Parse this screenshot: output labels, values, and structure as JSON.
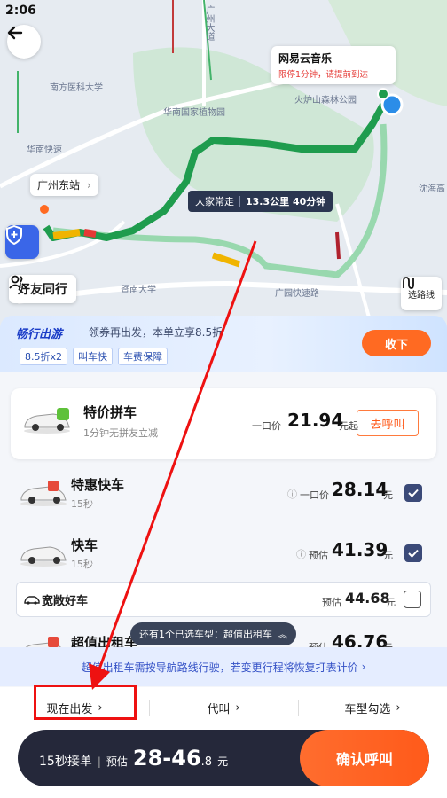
{
  "status": {
    "time": "2:06"
  },
  "map": {
    "start_label": "广州东站",
    "dest_name": "网易云音乐",
    "dest_note": "限停1分钟，请提前到达",
    "route_tip": {
      "tag": "大家常走",
      "detail": "13.3公里 40分钟"
    },
    "friends_label": "好友同行",
    "route_select_label": "选路线",
    "places": [
      "南方医科大学",
      "华南国家植物园",
      "火炉山森林公园",
      "暨南大学",
      "广园快速路",
      "沈海高",
      "广州大道",
      "华南快速"
    ]
  },
  "promo": {
    "logo": "畅行出游",
    "text": "领券再出发，本单立享8.5折",
    "tags": [
      "8.5折x2",
      "叫车快",
      "车费保障"
    ],
    "collect": "收下"
  },
  "cars": {
    "pool": {
      "name": "特价拼车",
      "sub": "1分钟无拼友立减",
      "price_label": "一口价",
      "price": "21.94",
      "unit": "元起",
      "call": "去呼叫"
    },
    "items": [
      {
        "name": "特惠快车",
        "sub": "15秒",
        "price_label": "一口价",
        "price": "28.14",
        "unit": "元",
        "checked": true
      },
      {
        "name": "快车",
        "sub": "15秒",
        "price_label": "预估",
        "price": "41.39",
        "unit": "元",
        "checked": true
      }
    ],
    "spacious": {
      "name": "宽敞好车",
      "price_label": "预估",
      "price": "44.68",
      "unit": "元"
    },
    "taxi": {
      "name": "超值出租车",
      "price_label": "预估",
      "price": "46.76",
      "unit": "元"
    },
    "more_pill": "还有1个已选车型：超值出租车",
    "notice": "超值出租车需按导航路线行驶，若变更行程将恢复打表计价"
  },
  "options": {
    "depart": "现在出发",
    "proxy": "代叫",
    "car_select": "车型勾选"
  },
  "bottom": {
    "pickup": "15秒接单",
    "est_label": "预估",
    "range_main": "28-46",
    "range_dec": ".8",
    "unit": "元",
    "confirm": "确认呼叫"
  }
}
